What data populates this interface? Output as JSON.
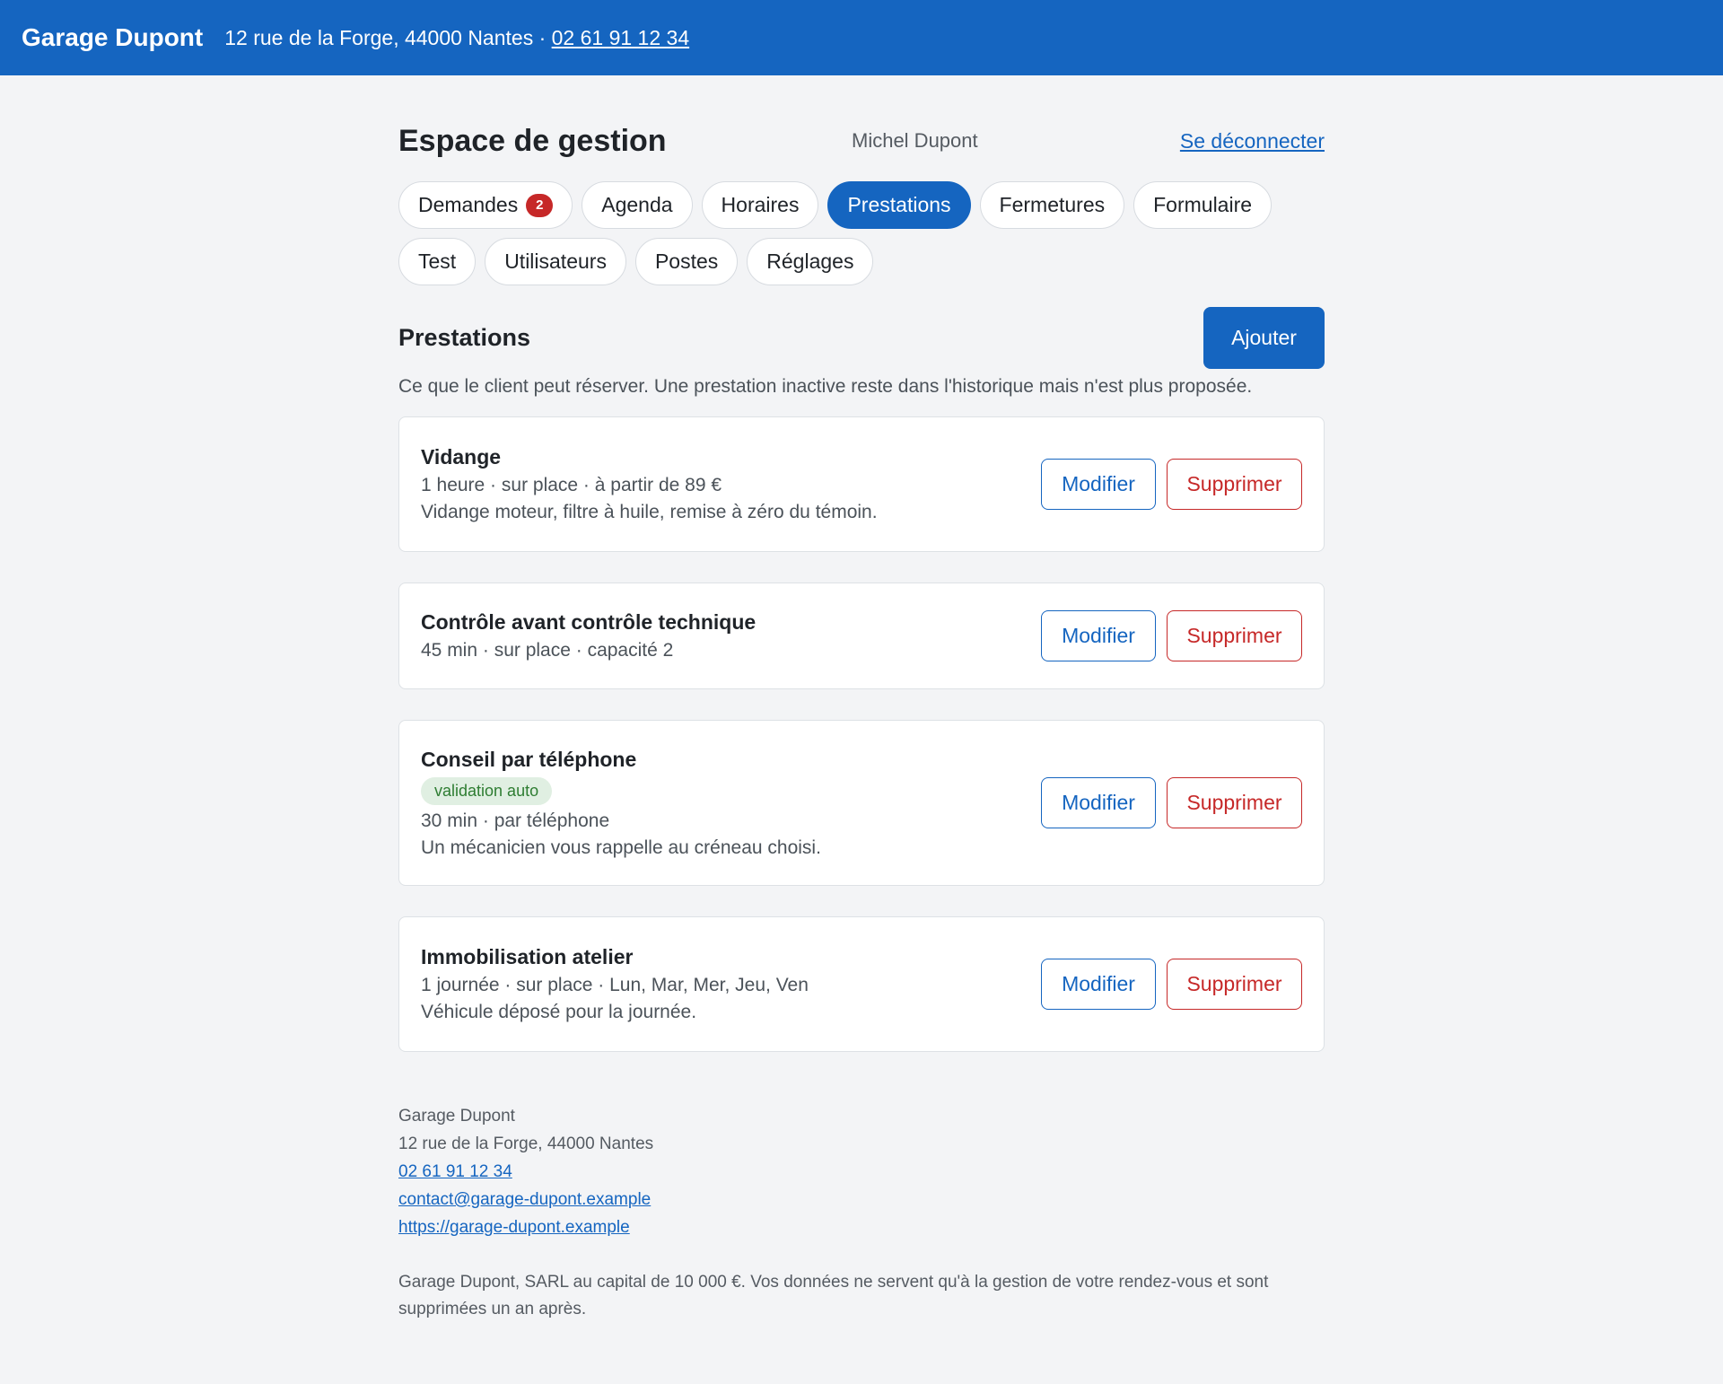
{
  "topbar": {
    "brand": "Garage Dupont",
    "address": "12 rue de la Forge, 44000 Nantes · ",
    "phone": "02 61 91 12 34"
  },
  "header": {
    "title": "Espace de gestion",
    "user": "Michel Dupont",
    "logout": "Se déconnecter"
  },
  "tabs": [
    {
      "label": "Demandes",
      "badge": "2"
    },
    {
      "label": "Agenda"
    },
    {
      "label": "Horaires"
    },
    {
      "label": "Prestations",
      "active": true
    },
    {
      "label": "Fermetures"
    },
    {
      "label": "Formulaire"
    },
    {
      "label": "Test"
    },
    {
      "label": "Utilisateurs"
    },
    {
      "label": "Postes"
    },
    {
      "label": "Réglages"
    }
  ],
  "section": {
    "title": "Prestations",
    "add_label": "Ajouter",
    "description": "Ce que le client peut réserver. Une prestation inactive reste dans l'historique mais n'est plus proposée."
  },
  "actions": {
    "edit": "Modifier",
    "delete": "Supprimer"
  },
  "services": [
    {
      "title": "Vidange",
      "meta": "1 heure · sur place · à partir de 89 €",
      "description": "Vidange moteur, filtre à huile, remise à zéro du témoin."
    },
    {
      "title": "Contrôle avant contrôle technique",
      "meta": "45 min · sur place · capacité 2"
    },
    {
      "title": "Conseil par téléphone",
      "badge": "validation auto",
      "meta": "30 min · par téléphone",
      "description": "Un mécanicien vous rappelle au créneau choisi."
    },
    {
      "title": "Immobilisation atelier",
      "meta": "1 journée · sur place · Lun, Mar, Mer, Jeu, Ven",
      "description": "Véhicule déposé pour la journée."
    }
  ],
  "footer": {
    "name": "Garage Dupont",
    "address": "12 rue de la Forge, 44000 Nantes",
    "phone": "02 61 91 12 34",
    "email": "contact@garage-dupont.example",
    "website": "https://garage-dupont.example",
    "legal": "Garage Dupont, SARL au capital de 10 000 €. Vos données ne servent qu'à la gestion de votre rendez-vous et sont supprimées un an après."
  },
  "colors": {
    "brand": "#1565c0",
    "danger": "#c62828",
    "success": "#2e7d32",
    "background": "#f3f4f6"
  }
}
